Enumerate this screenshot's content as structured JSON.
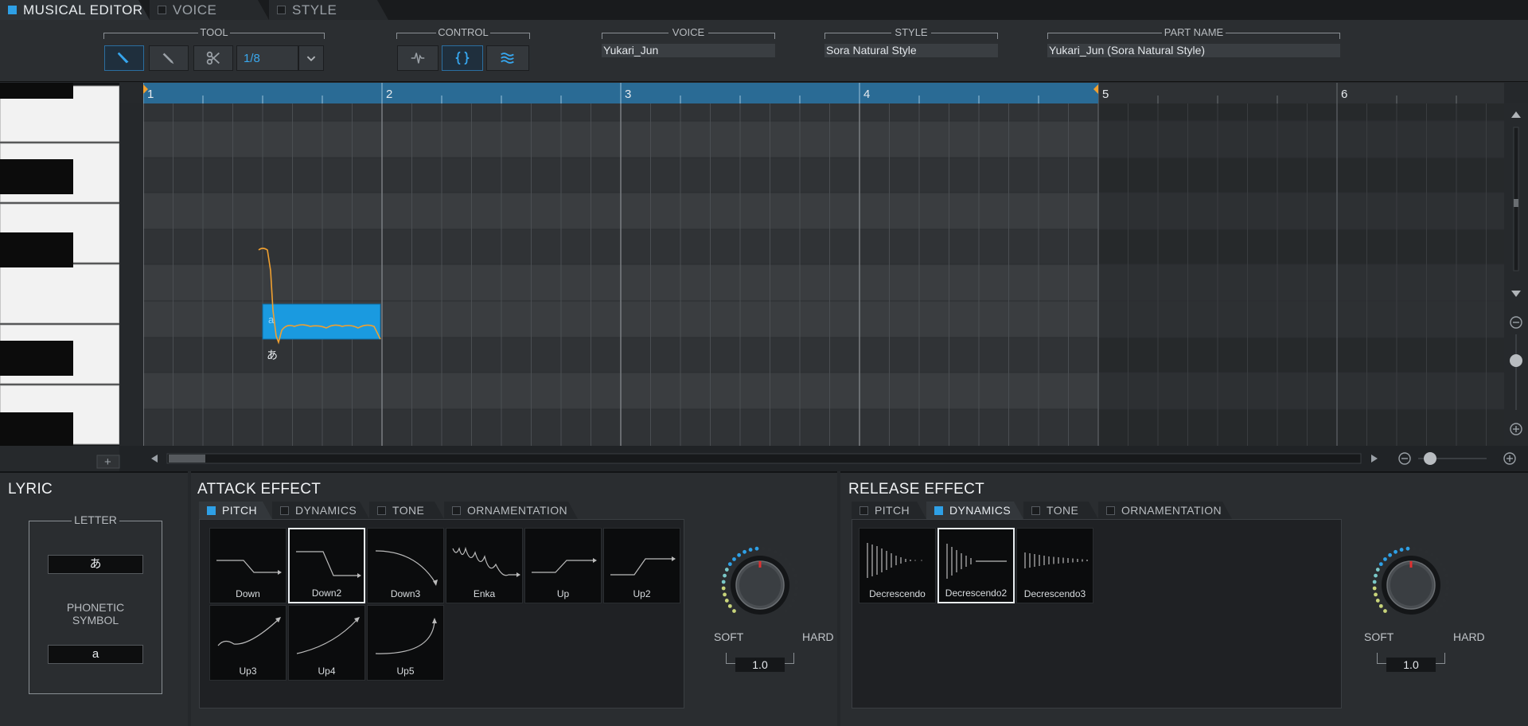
{
  "tabs": [
    {
      "label": "MUSICAL EDITOR",
      "active": true
    },
    {
      "label": "VOICE",
      "active": false
    },
    {
      "label": "STYLE",
      "active": false
    }
  ],
  "toolbar": {
    "tool_title": "TOOL",
    "tool_icons": [
      "pointer-icon",
      "pencil-icon",
      "scissors-icon"
    ],
    "quantize_value": "1/8",
    "control_title": "CONTROL",
    "control_icons": [
      "pitch-wave-icon",
      "code-brackets-icon",
      "vibrato-icon"
    ],
    "voice_title": "VOICE",
    "voice_value": "Yukari_Jun",
    "style_title": "STYLE",
    "style_value": "Sora Natural Style",
    "part_title": "PART NAME",
    "part_value": "Yukari_Jun (Sora Natural Style)"
  },
  "ruler": {
    "bars": [
      "1",
      "2",
      "3",
      "4",
      "5",
      "6"
    ]
  },
  "note": {
    "phoneme": "a",
    "lyric": "あ"
  },
  "lyric_panel": {
    "title": "LYRIC",
    "letter_title": "LETTER",
    "letter_value": "あ",
    "phonetic_title": "PHONETIC SYMBOL",
    "phonetic_value": "a"
  },
  "attack": {
    "title": "ATTACK EFFECT",
    "tabs": [
      {
        "label": "PITCH",
        "active": true
      },
      {
        "label": "DYNAMICS",
        "active": false
      },
      {
        "label": "TONE",
        "active": false
      },
      {
        "label": "ORNAMENTATION",
        "active": false
      }
    ],
    "effects": [
      "Down",
      "Down2",
      "Down3",
      "Enka",
      "Up",
      "Up2",
      "Up3",
      "Up4",
      "Up5"
    ],
    "selected": "Down2",
    "soft": "SOFT",
    "hard": "HARD",
    "value": "1.0"
  },
  "release": {
    "title": "RELEASE EFFECT",
    "tabs": [
      {
        "label": "PITCH",
        "active": false
      },
      {
        "label": "DYNAMICS",
        "active": true
      },
      {
        "label": "TONE",
        "active": false
      },
      {
        "label": "ORNAMENTATION",
        "active": false
      }
    ],
    "effects": [
      "Decrescendo",
      "Decrescendo2",
      "Decrescendo3"
    ],
    "selected": "Decrescendo2",
    "soft": "SOFT",
    "hard": "HARD",
    "value": "1.0"
  },
  "colors": {
    "accent": "#2ea0e6",
    "note": "#1a9ae0",
    "pitch_curve": "#f0a030",
    "ruler": "#2a6b95"
  }
}
